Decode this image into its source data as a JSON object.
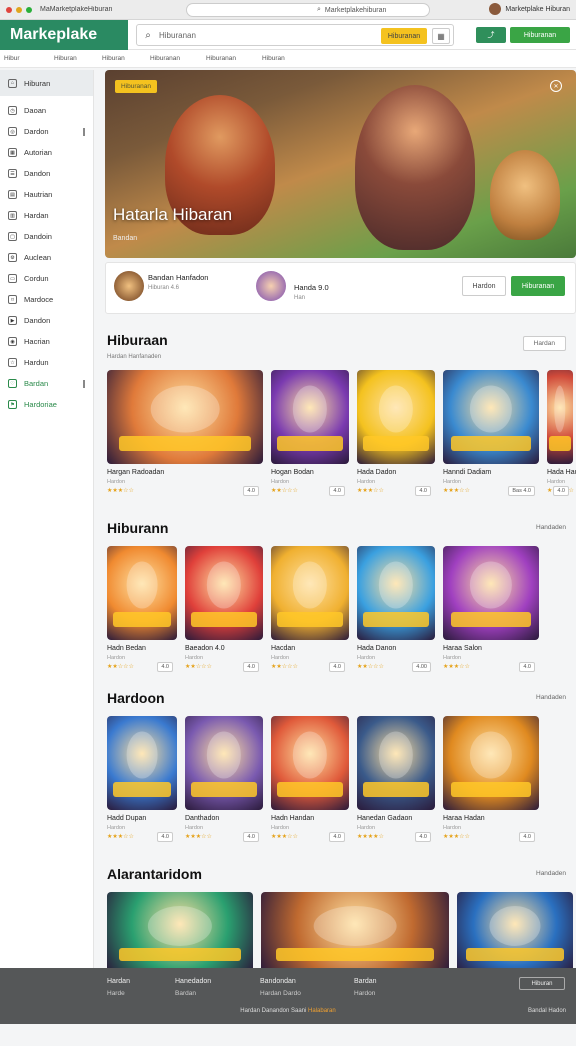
{
  "browser": {
    "tab_title": "MaMarketplakeHiburan",
    "url": "Marketplakehiburan",
    "user": "Marketplake Hiburan"
  },
  "header": {
    "logo": "Markeplake",
    "search_placeholder": "Hiburanan",
    "search_button": "Hiburanan",
    "button_icon": "Hiburan",
    "button_primary": "Hiburanan"
  },
  "subnav": [
    "Hibur",
    "Hiburan",
    "Hiburan",
    "Hiburanan",
    "Hiburanan",
    "Hiburan"
  ],
  "sidebar": {
    "items": [
      {
        "label": "Hiburan",
        "icon": "home-icon",
        "active": true
      },
      {
        "label": "Daoan",
        "icon": "clock-icon"
      },
      {
        "label": "Dardon",
        "icon": "compass-icon",
        "bar": true
      },
      {
        "label": "Autorian",
        "icon": "grid-icon"
      },
      {
        "label": "Dandon",
        "icon": "list-icon"
      },
      {
        "label": "Hautrian",
        "icon": "doc-icon"
      },
      {
        "label": "Hardan",
        "icon": "chart-icon"
      },
      {
        "label": "Dandoin",
        "icon": "box-icon"
      },
      {
        "label": "Auclean",
        "icon": "gear-icon"
      },
      {
        "label": "Cordun",
        "icon": "card-icon"
      },
      {
        "label": "Mardoce",
        "icon": "tag-icon"
      },
      {
        "label": "Dandon",
        "icon": "play-icon"
      },
      {
        "label": "Hacrian",
        "icon": "user-icon"
      },
      {
        "label": "Hardun",
        "icon": "star-icon"
      },
      {
        "label": "Bardan",
        "icon": "heart-icon",
        "green": true,
        "bar": true
      },
      {
        "label": "Hardoriae",
        "icon": "flag-icon",
        "green": true
      }
    ]
  },
  "hero": {
    "badge": "Hiburanan",
    "title": "Hatarla Hibaran",
    "subtitle": "Bandan"
  },
  "info_card": {
    "name1": "Bandan Hanfadon",
    "meta1": "Hiburan 4.6",
    "name2": "Handa 9.0",
    "meta2": "Han",
    "btn_outline": "Hardon",
    "btn_primary": "Hiburanan"
  },
  "sections": [
    {
      "title": "Hiburaan",
      "subtitle": "Hardan Hanfanaden",
      "more": "Hardan",
      "cards": [
        {
          "name": "Hargan Radoadan",
          "meta": "Hardon",
          "stars": "★★★☆☆",
          "price": "4.0"
        },
        {
          "name": "Hogan Bodan",
          "meta": "Hardon",
          "stars": "★★☆☆☆",
          "price": "4.0"
        },
        {
          "name": "Hada Dadon",
          "meta": "Hardon",
          "stars": "★★★☆☆",
          "price": "4.0"
        },
        {
          "name": "Hanndi Dadiam",
          "meta": "Hardon",
          "stars": "★★★☆☆",
          "price": "Bas 4.0"
        },
        {
          "name": "Hada Hau Doda",
          "meta": "Hardon",
          "stars": "★★★☆☆",
          "price": "4.0"
        }
      ]
    },
    {
      "title": "Hiburann",
      "subtitle": "",
      "more": "Handaden",
      "cards": [
        {
          "name": "Hadn Bedan",
          "meta": "Hardon",
          "stars": "★★☆☆☆",
          "price": "4.0"
        },
        {
          "name": "Baeadon 4.0",
          "meta": "Hardon",
          "stars": "★★☆☆☆",
          "price": "4.0"
        },
        {
          "name": "Hacdan",
          "meta": "Hardon",
          "stars": "★★☆☆☆",
          "price": "4.0"
        },
        {
          "name": "Hada Danon",
          "meta": "Hardon",
          "stars": "★★☆☆☆",
          "price": "4.00"
        },
        {
          "name": "Haraa Salon",
          "meta": "Hardon",
          "stars": "★★★☆☆",
          "price": "4.0"
        }
      ]
    },
    {
      "title": "Hardoon",
      "subtitle": "",
      "more": "Handaden",
      "cards": [
        {
          "name": "Hadd Dupan",
          "meta": "Hardon",
          "stars": "★★★☆☆",
          "price": "4.0"
        },
        {
          "name": "Danthadon",
          "meta": "Hardon",
          "stars": "★★★☆☆",
          "price": "4.0"
        },
        {
          "name": "Hadn Handan",
          "meta": "Hardon",
          "stars": "★★★☆☆",
          "price": "4.0"
        },
        {
          "name": "Hanedan Gadaon",
          "meta": "Hardon",
          "stars": "★★★★☆",
          "price": "4.0"
        },
        {
          "name": "Haraa Hadan",
          "meta": "Hardon",
          "stars": "★★★☆☆",
          "price": "4.0"
        }
      ]
    },
    {
      "title": "Alarantaridom",
      "subtitle": "",
      "more": "Handaden",
      "cards": [
        {
          "name": "",
          "meta": "",
          "stars": "",
          "price": ""
        },
        {
          "name": "",
          "meta": "",
          "stars": "",
          "price": ""
        },
        {
          "name": "",
          "meta": "",
          "stars": "",
          "price": ""
        }
      ]
    }
  ],
  "footer": {
    "cols": [
      {
        "title": "Hardan",
        "sub": "Harde"
      },
      {
        "title": "Hanedadon",
        "sub": "Bardan"
      },
      {
        "title": "Bandondan",
        "sub": "Hardan Dardo"
      },
      {
        "title": "Bardan",
        "sub": "Hardon"
      }
    ],
    "button": "Hiburan",
    "copyright": "Hardan Danandon Saani Halabaran",
    "accent_part": "Halabaran",
    "right": "Bandal Hadon"
  },
  "colors": {
    "brand": "#2a8a62",
    "accent": "#f4c21f",
    "primary_button": "#3aa545",
    "footer": "#555758"
  }
}
